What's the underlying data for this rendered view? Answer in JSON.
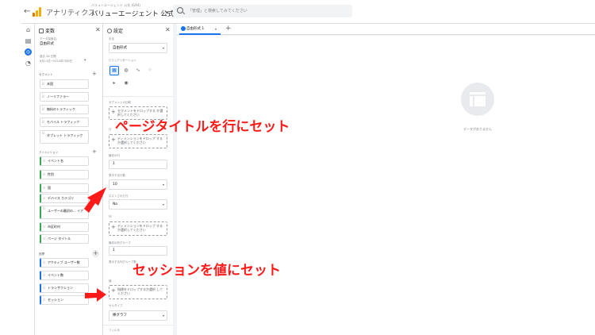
{
  "header": {
    "back": "←",
    "app_name": "アナリティクス",
    "account_path": "バリューエージェント 公式 (GA4)",
    "property_name": "バリューエージェント 公式し...",
    "search_placeholder": "「管理」と検索してみてください"
  },
  "rail": {
    "home_icon": "⌂",
    "reports_icon": "▤",
    "explore_icon": "◎",
    "advertising_icon": "◔"
  },
  "variables_panel": {
    "title": "変数",
    "close": "✕",
    "exploration_name_label": "データ探索名:",
    "exploration_name": "自由形式",
    "date_label": "過去 28 日間",
    "date_range": "6月11日〜2024年7月8日",
    "segments_label": "セグメント",
    "segments": [
      "未国",
      "ノーリファラー",
      "無料のトラフィック",
      "モバイル トラフィック",
      "タブレット トラフィック"
    ],
    "dimensions_label": "ディメンション",
    "dimensions": [
      "イベント名",
      "性別",
      "国",
      "デバイス カテゴリ",
      "ユーザーの最初の... イア",
      "市区町村",
      "ページ タイトル"
    ],
    "metrics_label": "指標",
    "metrics": [
      "アクティブ ユーザー数",
      "イベント数",
      "トランザクション",
      "セッション"
    ],
    "plus": "+"
  },
  "settings_panel": {
    "title": "設定",
    "close": "✕",
    "technique_label": "手法",
    "technique_value": "自由形式",
    "visualization_label": "ビジュアリゼーション",
    "segment_compare_label": "セグメントの比較",
    "segment_drop": "セグメントをドロップする か選択してください",
    "rows_label": "行",
    "rows_drop": "ディメンションをドロップ するか選択してください",
    "start_row_label": "最初の行",
    "start_row_value": "1",
    "show_rows_label": "表示する行数",
    "show_rows_value": "10",
    "nested_rows_label": "ネストされた行",
    "nested_rows_value": "No",
    "columns_label": "列",
    "columns_drop": "ディメンションをドロップ するか選択してください",
    "start_col_label": "最初の列グループ",
    "start_col_value": "1",
    "show_cols_label": "表示する列グループ数",
    "values_label": "値",
    "values_drop": "指標をドロップするか選択 してください",
    "cell_type_label": "セルタイプ",
    "cell_type_value": "棒グラフ",
    "filter_label": "フィルタ",
    "caret": "▾"
  },
  "canvas": {
    "tab_label": "自由形式 1",
    "tab_caret": "▾",
    "add_tab": "+",
    "empty_message": "データがありません"
  },
  "annotations": {
    "rows": "ページタイトルを行にセット",
    "values": "セッションを値にセット"
  },
  "colors": {
    "accent": "#1a73e8",
    "annotation": "#ff1a1a",
    "dimension": "#34a853"
  }
}
